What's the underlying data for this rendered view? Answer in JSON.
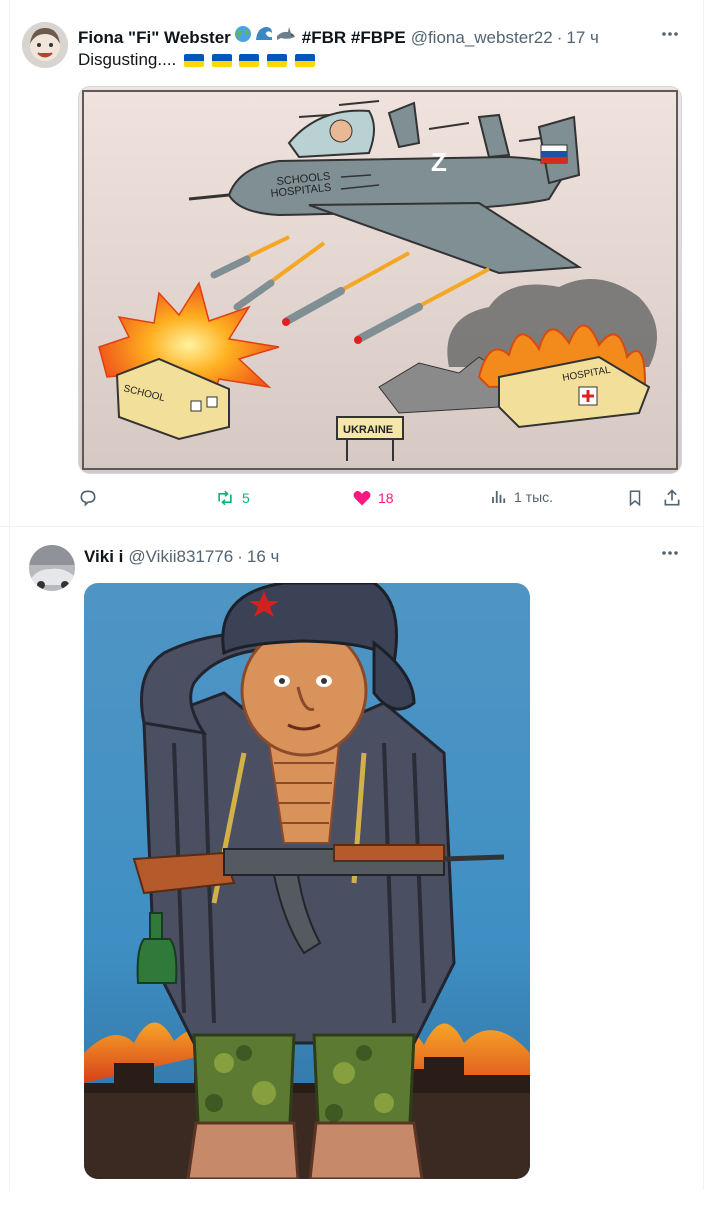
{
  "tweets": [
    {
      "display_name": "Fiona \"Fi\" Webster",
      "name_emojis": [
        "globe-icon",
        "wave-icon",
        "shark-icon"
      ],
      "hashtags": "#FBR #FBPE",
      "handle": "@fiona_webster22",
      "separator": "·",
      "time": "17 ч",
      "text": "Disgusting....",
      "flags_count": 5,
      "image_alt": "Cartoon: a Russian fighter jet with a pilot and Z marking drops missiles on a burning school and hospital near an UKRAINE sign",
      "cartoon_labels": {
        "plane_text_1": "SCHOOLS",
        "plane_text_2": "HOSPITALS",
        "plane_z": "Z",
        "school": "SCHOOL",
        "hospital": "HOSPITAL",
        "sign": "UKRAINE"
      },
      "actions": {
        "reply_count": "",
        "retweet_count": "5",
        "like_count": "18",
        "views_count": "1 тыс."
      },
      "colors": {
        "retweet": "#00ba7c",
        "like": "#f91880"
      }
    },
    {
      "display_name": "Viki i",
      "handle": "@Vikii831776",
      "separator": "·",
      "time": "16 ч",
      "image_alt": "Painting of a saluting soldier figure in a fur hat with a star, holding an assault rifle and a bottle, burning buildings in the background"
    }
  ]
}
